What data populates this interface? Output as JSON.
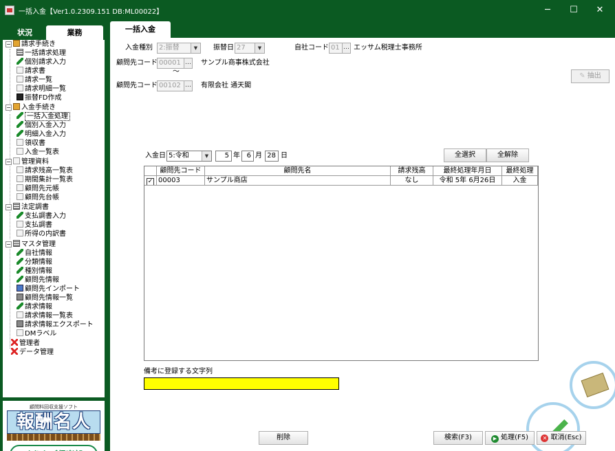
{
  "window": {
    "title": "一括入金【Ver1.0.2309.151 DB:ML00022】",
    "minimize": "─",
    "maximize": "☐",
    "close": "✕"
  },
  "left_tabs": {
    "status": "状況",
    "business": "業務"
  },
  "tree": {
    "billing": "請求手続き",
    "bulk_billing": "一括請求処理",
    "single_billing": "個別請求入力",
    "invoice": "請求書",
    "billing_list": "請求一覧",
    "billing_detail_list": "請求明細一覧",
    "transfer_fd": "振替FD作成",
    "payment": "入金手続き",
    "bulk_payment": "一括入金処理",
    "single_payment": "個別入金入力",
    "detail_payment": "明細入金入力",
    "receipt": "領収書",
    "payment_list": "入金一覧表",
    "management": "管理資料",
    "balance_list": "請求残高一覧表",
    "period_summary": "期間集計一覧表",
    "advisor_ledger": "顧問先元帳",
    "advisor_register": "顧問先台帳",
    "statutory": "法定調書",
    "payment_record_input": "支払調書入力",
    "payment_record": "支払調書",
    "income_detail": "所得の内訳書",
    "master": "マスタ管理",
    "company_info": "自社情報",
    "category_info": "分類情報",
    "type_info": "種別情報",
    "advisor_info": "顧問先情報",
    "advisor_import": "顧問先インポート",
    "advisor_info_list": "顧問先情報一覧",
    "billing_info": "請求情報",
    "billing_info_list": "請求情報一覧表",
    "billing_info_export": "請求情報エクスポート",
    "dm_label": "DMラベル",
    "admin": "管理者",
    "data_mgmt": "データ管理"
  },
  "logo": {
    "subtitle": "顧問料回収支援ソフト",
    "name": "報酬名人",
    "club": "ゆりかご倶楽部"
  },
  "main_tab": "一括入金",
  "form": {
    "payment_type_label": "入金種別",
    "payment_type_value": "2:振替",
    "transfer_day_label": "振替日",
    "transfer_day_value": "27",
    "company_code_label": "自社コード",
    "company_code_value": "01",
    "company_name": "エッサム税理士事務所",
    "advisor_code_label": "顧問先コード",
    "advisor_code_from": "00001",
    "advisor_from_name": "サンプル商事株式会社",
    "range_sep": "〜",
    "advisor_code_to": "00102",
    "advisor_to_name": "有限会社 通天閣",
    "extract_button": "抽出",
    "date_label": "入金日",
    "era": "5:令和",
    "year": "5",
    "year_unit": "年",
    "month": "6",
    "month_unit": "月",
    "day": "28",
    "day_unit": "日",
    "select_all": "全選択",
    "deselect_all": "全解除"
  },
  "table": {
    "headers": [
      "顧問先コード",
      "顧問先名",
      "請求残高",
      "最終処理年月日",
      "最終処理"
    ],
    "rows": [
      {
        "checked": "✓",
        "code": "00003",
        "name": "サンプル商店",
        "balance": "なし",
        "last_date": "令和 5年 6月26日",
        "last_process": "入金"
      }
    ]
  },
  "remark_label": "備考に登録する文字列",
  "remark_value": "",
  "buttons": {
    "delete": "削除",
    "search": "検索(F3)",
    "process": "処理(F5)",
    "cancel": "取消(Esc)"
  }
}
